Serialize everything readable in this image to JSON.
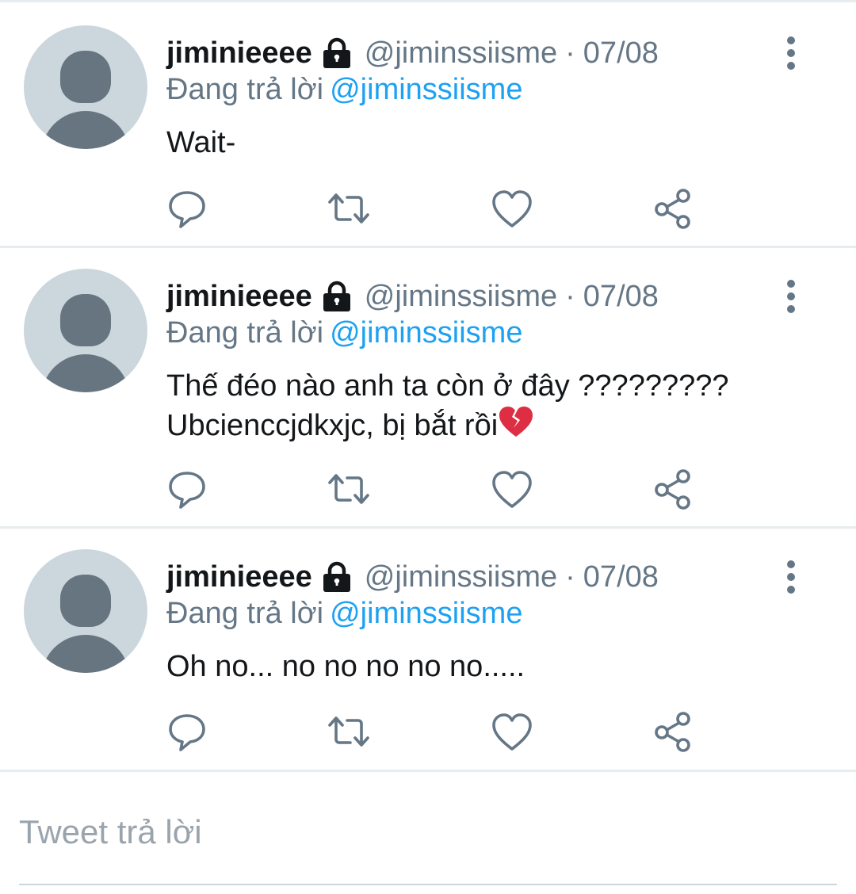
{
  "tweets": [
    {
      "display_name": "jiminieeee",
      "handle": "@jiminssiisme",
      "separator": "·",
      "date": "07/08",
      "replying_prefix": "Đang trả lời",
      "replying_to": "@jiminssiisme",
      "text": "Wait-",
      "has_emoji": false
    },
    {
      "display_name": "jiminieeee",
      "handle": "@jiminssiisme",
      "separator": "·",
      "date": "07/08",
      "replying_prefix": "Đang trả lời",
      "replying_to": "@jiminssiisme",
      "text": "Thế đéo nào anh ta còn ở đây ?????????\nUbcienccjdkxjc, bị bắt rồi",
      "has_emoji": true,
      "emoji": "broken-heart-icon"
    },
    {
      "display_name": "jiminieeee",
      "handle": "@jiminssiisme",
      "separator": "·",
      "date": "07/08",
      "replying_prefix": "Đang trả lời",
      "replying_to": "@jiminssiisme",
      "text": "Oh no... no no no no no.....",
      "has_emoji": false
    }
  ],
  "icons": {
    "lock": "lock-icon",
    "more": "more-vertical-icon",
    "reply": "reply-icon",
    "retweet": "retweet-icon",
    "like": "like-heart-icon",
    "share": "share-icon"
  },
  "reply_box": {
    "placeholder": "Tweet trả lời"
  },
  "colors": {
    "text": "#14171a",
    "secondary": "#657786",
    "link": "#1da1f2",
    "avatar_bg": "#ccd6dd",
    "avatar_fg": "#66757f",
    "divider": "#e6ecf0",
    "icon": "#657786",
    "broken_heart": "#dd2e44"
  }
}
